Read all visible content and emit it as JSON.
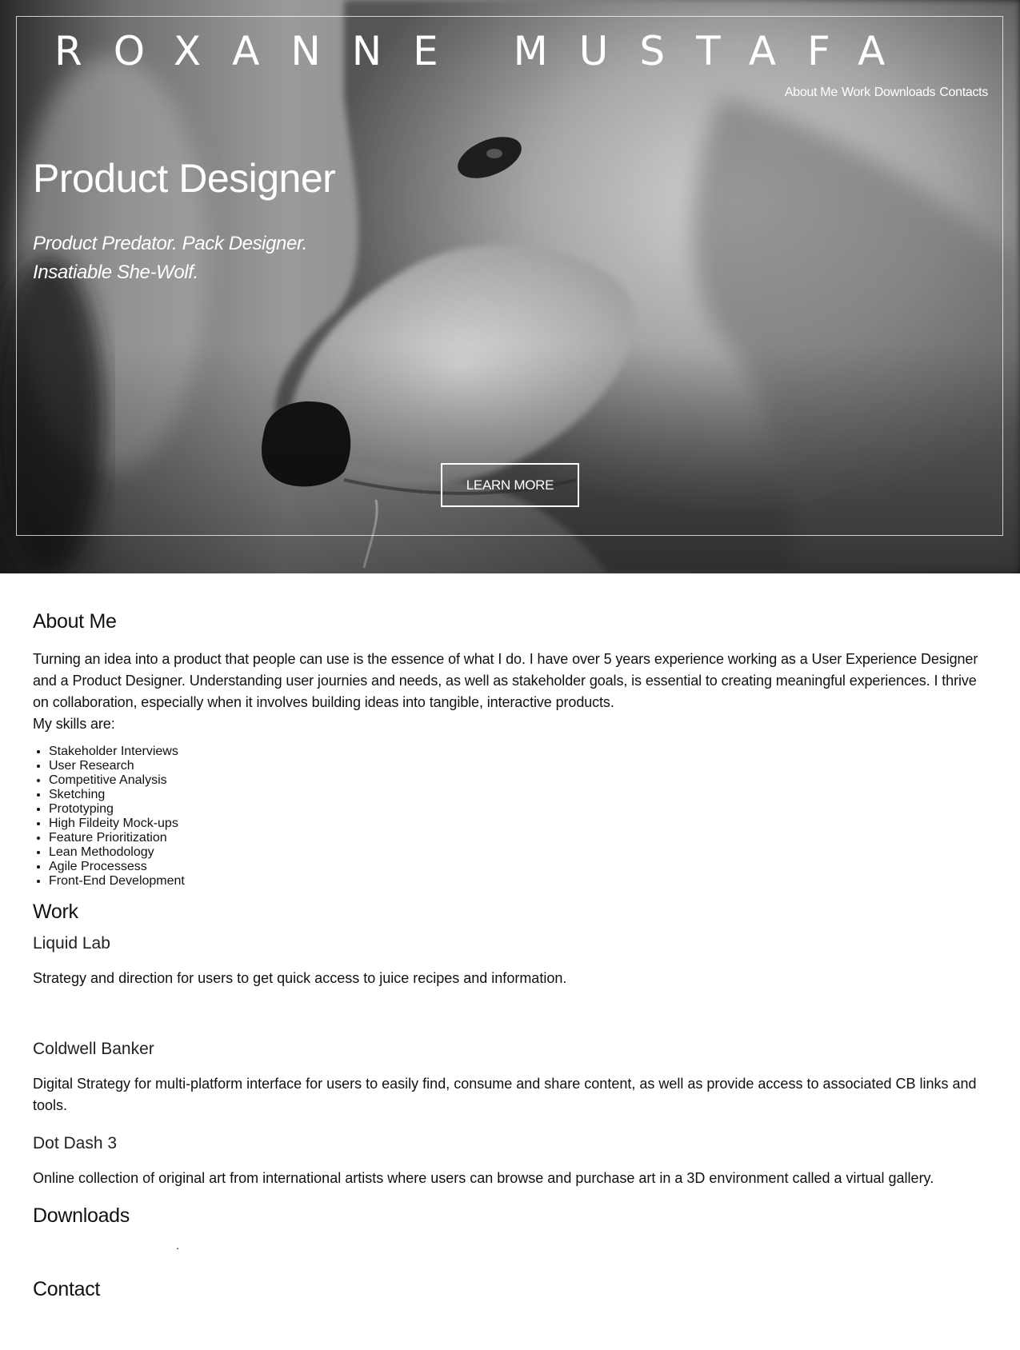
{
  "header": {
    "site_title": "ROXANNE MUSTAFA",
    "nav": [
      "About Me",
      "Work",
      "Downloads",
      "Contacts"
    ]
  },
  "hero": {
    "heading": "Product Designer",
    "tagline_line1": "Product Predator. Pack Designer.",
    "tagline_line2": "Insatiable She-Wolf.",
    "cta_label": "LEARN MORE"
  },
  "about": {
    "heading": "About Me",
    "paragraph": "Turning an idea into a product that people can use is the essence of what I do. I have over 5 years experience working as a User Experience Designer and a Product Designer. Understanding user journies and needs, as well as stakeholder goals, is essential to creating meaningful experiences. I thrive on collaboration, especially when it involves building ideas into tangible, interactive products.",
    "skills_intro": "My skills are:",
    "skills": [
      "Stakeholder Interviews",
      "User Research",
      "Competitive Analysis",
      "Sketching",
      "Prototyping",
      "High Fildeity Mock-ups",
      "Feature Prioritization",
      "Lean Methodology",
      "Agile Processess",
      "Front-End Development"
    ]
  },
  "work": {
    "heading": "Work",
    "projects": [
      {
        "title": "Liquid Lab",
        "description": "Strategy and direction for users to get quick access to juice recipes and information."
      },
      {
        "title": "Coldwell Banker",
        "description": "Digital Strategy for multi-platform interface for users to easily find, consume and share content, as well as provide access to associated CB links and tools."
      },
      {
        "title": "Dot Dash 3",
        "description": "Online collection of original art from international artists where users can browse and purchase art in a 3D environment called a virtual gallery."
      }
    ]
  },
  "downloads": {
    "heading": "Downloads",
    "placeholder_text": "."
  },
  "contact": {
    "heading": "Contact"
  },
  "colors": {
    "hero_text": "#ffffff",
    "body_text": "#111111",
    "background": "#ffffff"
  }
}
